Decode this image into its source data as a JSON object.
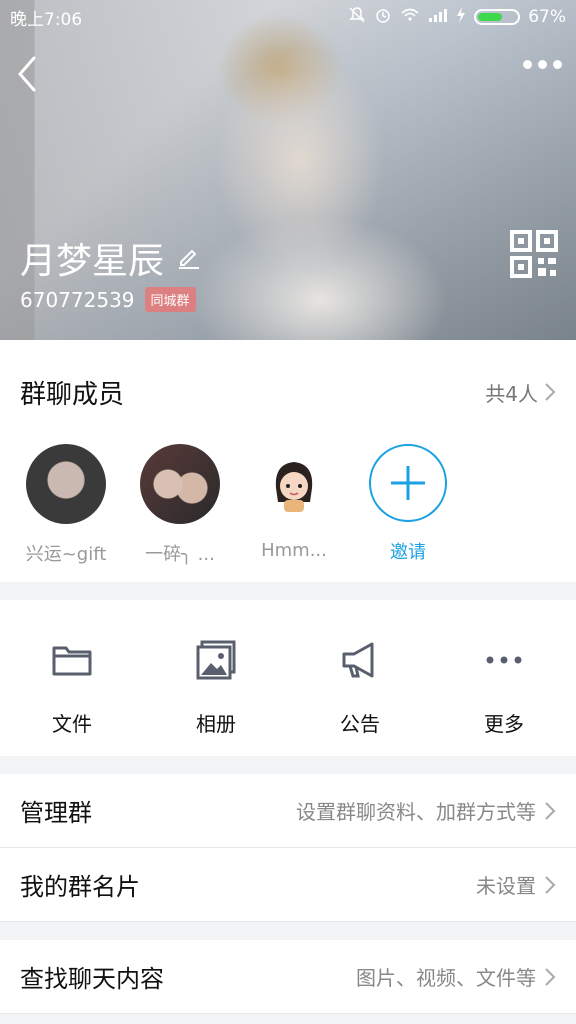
{
  "status_bar": {
    "time": "晚上7:06",
    "battery": "67%",
    "battery_level": 0.67
  },
  "header": {
    "group_name": "月梦星辰",
    "group_id": "670772539",
    "tag": "同城群"
  },
  "members": {
    "title": "群聊成员",
    "count": "共4人",
    "list": [
      {
        "name": "兴运~gift"
      },
      {
        "name": "一碎╮ ..."
      },
      {
        "name": "Hmm..."
      }
    ],
    "invite_label": "邀请"
  },
  "actions": [
    {
      "label": "文件",
      "icon": "folder-icon"
    },
    {
      "label": "相册",
      "icon": "album-icon"
    },
    {
      "label": "公告",
      "icon": "megaphone-icon"
    },
    {
      "label": "更多",
      "icon": "more-icon"
    }
  ],
  "settings": [
    {
      "title": "管理群",
      "value": "设置群聊资料、加群方式等"
    },
    {
      "title": "我的群名片",
      "value": "未设置"
    },
    {
      "title": "查找聊天内容",
      "value": "图片、视频、文件等"
    }
  ],
  "colors": {
    "accent": "#1aa1e0",
    "tag": "#e67878",
    "battery": "#3dd84c"
  }
}
